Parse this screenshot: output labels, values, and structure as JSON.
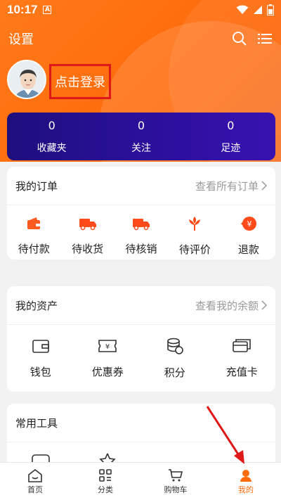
{
  "status_bar": {
    "time": "10:17",
    "a_icon": "A"
  },
  "header": {
    "title": "设置",
    "login_text": "点击登录"
  },
  "stats": [
    {
      "value": "0",
      "label": "收藏夹"
    },
    {
      "value": "0",
      "label": "关注"
    },
    {
      "value": "0",
      "label": "足迹"
    }
  ],
  "orders": {
    "title": "我的订单",
    "more": "查看所有订单",
    "items": [
      {
        "label": "待付款",
        "icon": "wallet-icon"
      },
      {
        "label": "待收货",
        "icon": "truck-icon"
      },
      {
        "label": "待核销",
        "icon": "truck-icon"
      },
      {
        "label": "待评价",
        "icon": "flower-icon"
      },
      {
        "label": "退款",
        "icon": "refund-icon"
      }
    ]
  },
  "assets": {
    "title": "我的资产",
    "more": "查看我的余额",
    "items": [
      {
        "label": "钱包",
        "icon": "wallet-outline-icon"
      },
      {
        "label": "优惠券",
        "icon": "coupon-icon"
      },
      {
        "label": "积分",
        "icon": "coins-icon"
      },
      {
        "label": "充值卡",
        "icon": "card-icon"
      }
    ]
  },
  "tools": {
    "title": "常用工具"
  },
  "nav": [
    {
      "label": "首页",
      "icon": "home-icon"
    },
    {
      "label": "分类",
      "icon": "category-icon"
    },
    {
      "label": "购物车",
      "icon": "cart-icon"
    },
    {
      "label": "我的",
      "icon": "user-icon"
    }
  ],
  "colors": {
    "accent": "#ff6a0a",
    "stats_bg": "#2a109a",
    "highlight": "#e01818"
  }
}
